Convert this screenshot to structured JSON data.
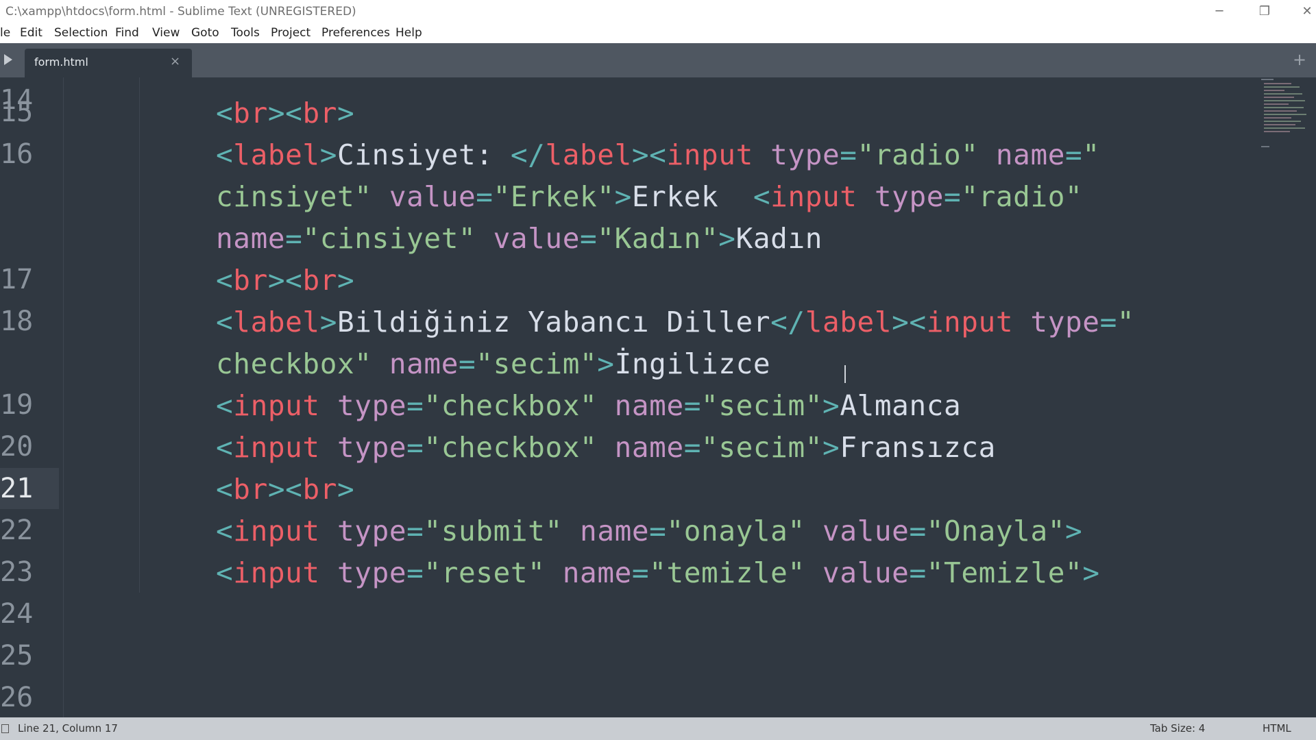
{
  "window": {
    "title": "C:\\xampp\\htdocs\\form.html - Sublime Text (UNREGISTERED)",
    "controls": {
      "minimize": "─",
      "maximize": "❐",
      "close": "✕"
    }
  },
  "menu": [
    "le",
    "Edit",
    "Selection",
    "Find",
    "View",
    "Goto",
    "Tools",
    "Project",
    "Preferences",
    "Help"
  ],
  "tabs": [
    {
      "label": "form.html",
      "close": "×"
    }
  ],
  "new_tab": "+",
  "editor": {
    "line_numbers": [
      "14",
      "15",
      "16",
      "17",
      "18",
      "19",
      "20",
      "21",
      "22",
      "23",
      "24",
      "25",
      "26"
    ],
    "current_line": "21"
  },
  "status": {
    "position": "Line 21, Column 17",
    "tab_size": "Tab Size: 4",
    "syntax": "HTML"
  },
  "colors": {
    "background": "#303841",
    "tag": "#ec5f67",
    "punctuation": "#5fb3b3",
    "attribute": "#c594c5",
    "string": "#99c794",
    "text": "#d8dee9"
  }
}
